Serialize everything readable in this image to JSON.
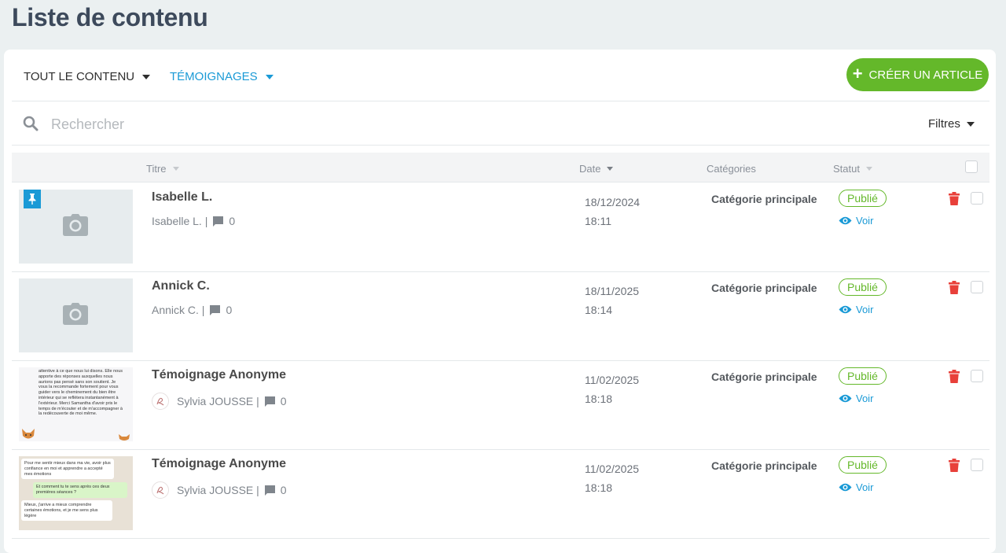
{
  "page": {
    "title": "Liste de contenu"
  },
  "toolbar": {
    "all_content": "TOUT LE CONTENU",
    "category": "TÉMOIGNAGES",
    "create_label": "CRÉER UN ARTICLE"
  },
  "search": {
    "placeholder": "Rechercher",
    "filters_label": "Filtres"
  },
  "table": {
    "headers": {
      "title": "Titre",
      "date": "Date",
      "categories": "Catégories",
      "status": "Statut"
    }
  },
  "rows": [
    {
      "title": "Isabelle L.",
      "author": "Isabelle L. |",
      "comments": "0",
      "date": "18/12/2024",
      "time": "18:11",
      "category": "Catégorie principale",
      "status": "Publié",
      "view": "Voir",
      "pinned": true
    },
    {
      "title": "Annick C.",
      "author": "Annick C. |",
      "comments": "0",
      "date": "18/11/2025",
      "time": "18:14",
      "category": "Catégorie principale",
      "status": "Publié",
      "view": "Voir"
    },
    {
      "title": "Témoignage Anonyme",
      "author": "Sylvia JOUSSE |",
      "comments": "0",
      "date": "11/02/2025",
      "time": "18:18",
      "category": "Catégorie principale",
      "status": "Publié",
      "view": "Voir",
      "thumb_text": "attentive à ce que nous lui disons. Elle nous apporte des réponses auxquelles nous aurions pas pensé sans son soutient. Je vous la recommande fortement pour vous guider vers le cheminement du bien être intérieur qui se reflètera instantanément à l'extérieur. Merci Samantha d'avoir pris le temps de m'écouter et de m'accompagner à la redécouverte de moi même."
    },
    {
      "title": "Témoignage Anonyme",
      "author": "Sylvia JOUSSE |",
      "comments": "0",
      "date": "11/02/2025",
      "time": "18:18",
      "category": "Catégorie principale",
      "status": "Publié",
      "view": "Voir",
      "chat": [
        "Pour me sentir mieux dans ma vie, avoir plus confiance en moi et apprendre a accepté mes émotions",
        "Et comment tu te sens après ces deux premières séances ?",
        "Mieux, j'arrive a mieux comprendre certaines émotions, et je me sens plus légère"
      ]
    }
  ],
  "colors": {
    "accent": "#1a9ad6",
    "success": "#64b82a",
    "danger": "#e8403a"
  },
  "icons": [
    "search-icon",
    "camera-icon",
    "pin-icon",
    "comment-icon",
    "eye-icon",
    "trash-icon",
    "caret-down-icon",
    "plus-icon"
  ]
}
